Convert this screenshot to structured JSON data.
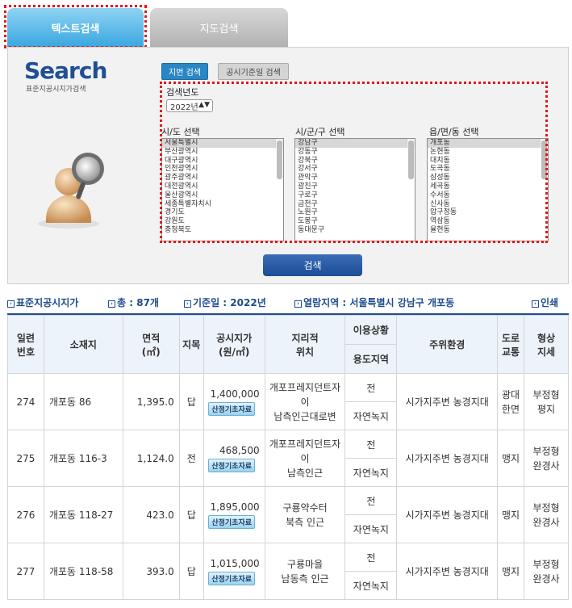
{
  "tabs": {
    "text_search": "텍스트검색",
    "map_search": "지도검색"
  },
  "panel": {
    "logo": "Search",
    "logo_sub": "표준지공시지가검색",
    "btn_jibun": "지번 검색",
    "btn_date": "공시기준일 검색",
    "year_label": "검색년도",
    "year_value": "2022년",
    "sido_label": "시/도 선택",
    "sigungu_label": "시/군/구 선택",
    "dong_label": "읍/면/동 선택",
    "sido": [
      "서울특별시",
      "부산광역시",
      "대구광역시",
      "인천광역시",
      "광주광역시",
      "대전광역시",
      "울산광역시",
      "세종특별자치시",
      "경기도",
      "강원도",
      "충청북도"
    ],
    "sigungu": [
      "강남구",
      "강동구",
      "강북구",
      "강서구",
      "관악구",
      "광진구",
      "구로구",
      "금천구",
      "노원구",
      "도봉구",
      "동대문구"
    ],
    "dong": [
      "개포동",
      "논현동",
      "대치동",
      "도곡동",
      "삼성동",
      "세곡동",
      "수서동",
      "신사동",
      "압구정동",
      "역삼동",
      "율현동"
    ],
    "search_button": "검색"
  },
  "summary": {
    "title": "표준지공시지가",
    "total_label": "총 :",
    "total_value": "87개",
    "date_label": "기준일 :",
    "date_value": "2022년",
    "region_label": "열람지역 :",
    "region_value": "서울특별시 강남구 개포동",
    "print": "인쇄"
  },
  "table": {
    "headers": {
      "no": "일련\n번호",
      "addr": "소재지",
      "area": "면적\n(㎡)",
      "jimok": "지목",
      "price": "공시지가\n(원/㎡)",
      "geo": "지리적\n위치",
      "usage": "이용상황",
      "zone": "용도지역",
      "env": "주위환경",
      "road": "도로\n교통",
      "shape": "형상\n지세"
    },
    "badge": "산정기초자료",
    "rows": [
      {
        "no": "274",
        "addr": "개포동 86",
        "area": "1,395.0",
        "jimok": "답",
        "price": "1,400,000",
        "geo": "개포프레지던트자이\n남측인근대로변",
        "usage": "전",
        "zone": "자연녹지",
        "env": "시가지주변 농경지대",
        "road": "광대\n한면",
        "shape": "부정형\n평지"
      },
      {
        "no": "275",
        "addr": "개포동 116-3",
        "area": "1,124.0",
        "jimok": "전",
        "price": "468,500",
        "geo": "개포프레지던트자이\n남측인근",
        "usage": "전",
        "zone": "자연녹지",
        "env": "시가지주변 농경지대",
        "road": "맹지",
        "shape": "부정형\n완경사"
      },
      {
        "no": "276",
        "addr": "개포동 118-27",
        "area": "423.0",
        "jimok": "답",
        "price": "1,895,000",
        "geo": "구룡약수터\n북측 인근",
        "usage": "전",
        "zone": "자연녹지",
        "env": "시가지주변 농경지대",
        "road": "맹지",
        "shape": "부정형\n완경사"
      },
      {
        "no": "277",
        "addr": "개포동 118-58",
        "area": "393.0",
        "jimok": "답",
        "price": "1,015,000",
        "geo": "구룡마을\n남동측 인근",
        "usage": "전",
        "zone": "자연녹지",
        "env": "시가지주변 농경지대",
        "road": "맹지",
        "shape": "부정형\n완경사"
      }
    ]
  }
}
